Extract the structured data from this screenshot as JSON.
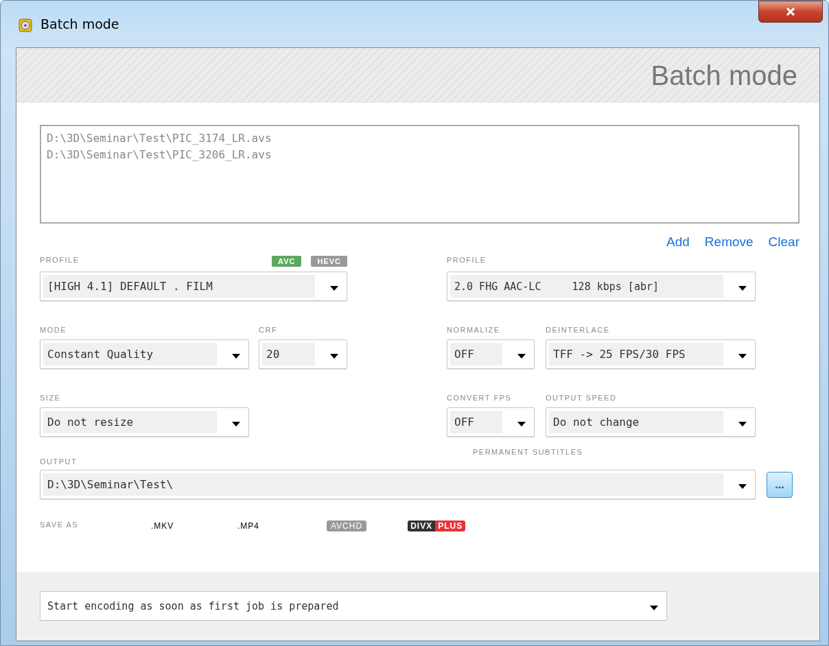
{
  "window": {
    "title": "Batch mode"
  },
  "header": {
    "title": "Batch mode"
  },
  "file_list": [
    "D:\\3D\\Seminar\\Test\\PIC_3174_LR.avs",
    "D:\\3D\\Seminar\\Test\\PIC_3206_LR.avs"
  ],
  "list_actions": [
    "Add",
    "Remove",
    "Clear"
  ],
  "video": {
    "profile_label": "PROFILE",
    "codecs": [
      {
        "label": "AVC",
        "selected": true
      },
      {
        "label": "HEVC",
        "selected": false
      }
    ],
    "profile": "[HIGH 4.1] DEFAULT . FILM",
    "mode_label": "MODE",
    "mode": "Constant Quality",
    "crf_label": "CRF",
    "crf": "20",
    "size_label": "SIZE",
    "size": "Do not resize"
  },
  "audio": {
    "profile_label": "PROFILE",
    "profile": "2.0 FHG AAC-LC     128 kbps [abr]",
    "normalize_label": "NORMALIZE",
    "normalize": "OFF",
    "deinterlace_label": "DEINTERLACE",
    "deinterlace": "TFF -> 25 FPS/30 FPS",
    "convert_fps_label": "CONVERT FPS",
    "convert_fps": "OFF",
    "output_speed_label": "OUTPUT SPEED",
    "output_speed": "Do not change"
  },
  "output": {
    "label": "OUTPUT",
    "subtitles_label": "PERMANENT SUBTITLES",
    "path": "D:\\3D\\Seminar\\Test\\",
    "browse_button": "..."
  },
  "save_as": {
    "label": "SAVE AS",
    "formats": [
      {
        "kind": "text",
        "label": ".MKV"
      },
      {
        "kind": "text",
        "label": ".MP4"
      },
      {
        "kind": "badge",
        "label": "AVCHD"
      },
      {
        "kind": "split",
        "label": "DIVX",
        "suffix": "PLUS"
      }
    ]
  },
  "start_mode": "Start encoding as soon as first job is prepared"
}
